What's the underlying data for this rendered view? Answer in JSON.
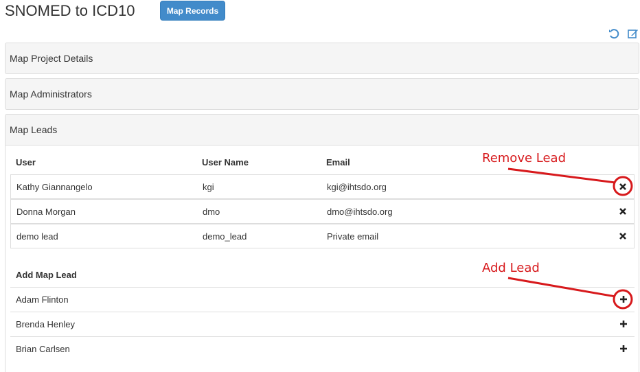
{
  "header": {
    "title": "SNOMED to ICD10",
    "map_records_label": "Map Records"
  },
  "toolbar": {
    "icons": [
      "undo-icon",
      "edit-icon"
    ]
  },
  "panels": [
    {
      "label": "Map Project Details"
    },
    {
      "label": "Map Administrators"
    },
    {
      "label": "Map Leads"
    }
  ],
  "leads": {
    "columns": [
      "User",
      "User Name",
      "Email"
    ],
    "rows": [
      {
        "user": "Kathy Giannangelo",
        "username": "kgi",
        "email": "kgi@ihtsdo.org"
      },
      {
        "user": "Donna Morgan",
        "username": "dmo",
        "email": "dmo@ihtsdo.org"
      },
      {
        "user": "demo lead",
        "username": "demo_lead",
        "email": "Private email"
      }
    ]
  },
  "add_leads": {
    "title": "Add Map Lead",
    "rows": [
      {
        "user": "Adam Flinton"
      },
      {
        "user": "Brenda Henley"
      },
      {
        "user": "Brian Carlsen"
      }
    ]
  },
  "annotations": {
    "remove": "Remove Lead",
    "add": "Add Lead",
    "color": "#d7191c"
  },
  "colors": {
    "primary": "#428bca",
    "panel_bg": "#f5f5f5",
    "border": "#dddddd"
  }
}
